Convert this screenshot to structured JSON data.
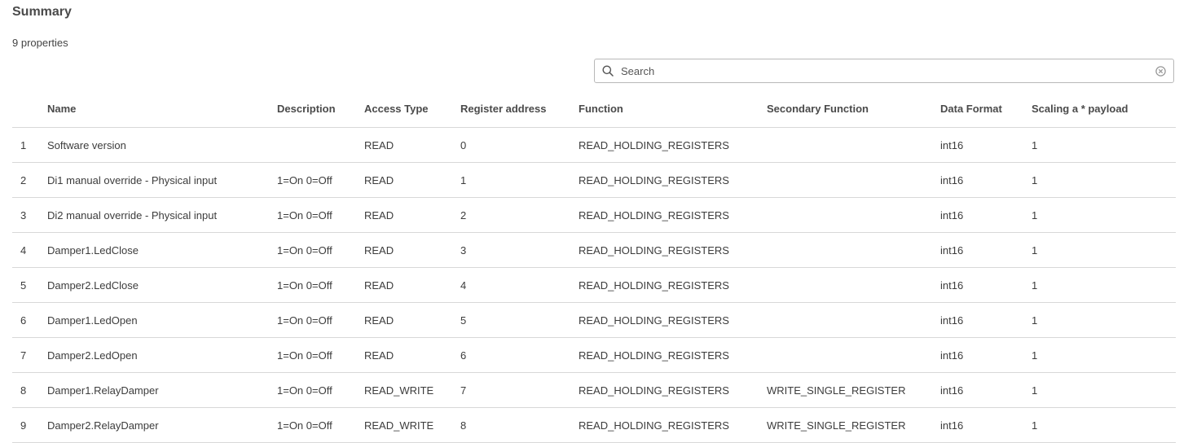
{
  "header": {
    "title": "Summary",
    "count_text": "9 properties"
  },
  "search": {
    "placeholder": "Search",
    "value": "",
    "icon": "search-icon",
    "clear_icon": "clear-icon"
  },
  "table": {
    "columns": {
      "index": "",
      "name": "Name",
      "description": "Description",
      "access_type": "Access Type",
      "register_address": "Register address",
      "function": "Function",
      "secondary_function": "Secondary Function",
      "data_format": "Data Format",
      "scaling": "Scaling a * payload"
    },
    "rows": [
      {
        "index": "1",
        "name": "Software version",
        "description": "",
        "access_type": "READ",
        "register_address": "0",
        "function": "READ_HOLDING_REGISTERS",
        "secondary_function": "",
        "data_format": "int16",
        "scaling": "1"
      },
      {
        "index": "2",
        "name": "Di1 manual override - Physical input",
        "description": "1=On 0=Off",
        "access_type": "READ",
        "register_address": "1",
        "function": "READ_HOLDING_REGISTERS",
        "secondary_function": "",
        "data_format": "int16",
        "scaling": "1"
      },
      {
        "index": "3",
        "name": "Di2 manual override - Physical input",
        "description": "1=On 0=Off",
        "access_type": "READ",
        "register_address": "2",
        "function": "READ_HOLDING_REGISTERS",
        "secondary_function": "",
        "data_format": "int16",
        "scaling": "1"
      },
      {
        "index": "4",
        "name": "Damper1.LedClose",
        "description": "1=On 0=Off",
        "access_type": "READ",
        "register_address": "3",
        "function": "READ_HOLDING_REGISTERS",
        "secondary_function": "",
        "data_format": "int16",
        "scaling": "1"
      },
      {
        "index": "5",
        "name": "Damper2.LedClose",
        "description": "1=On 0=Off",
        "access_type": "READ",
        "register_address": "4",
        "function": "READ_HOLDING_REGISTERS",
        "secondary_function": "",
        "data_format": "int16",
        "scaling": "1"
      },
      {
        "index": "6",
        "name": "Damper1.LedOpen",
        "description": "1=On 0=Off",
        "access_type": "READ",
        "register_address": "5",
        "function": "READ_HOLDING_REGISTERS",
        "secondary_function": "",
        "data_format": "int16",
        "scaling": "1"
      },
      {
        "index": "7",
        "name": "Damper2.LedOpen",
        "description": "1=On 0=Off",
        "access_type": "READ",
        "register_address": "6",
        "function": "READ_HOLDING_REGISTERS",
        "secondary_function": "",
        "data_format": "int16",
        "scaling": "1"
      },
      {
        "index": "8",
        "name": "Damper1.RelayDamper",
        "description": "1=On 0=Off",
        "access_type": "READ_WRITE",
        "register_address": "7",
        "function": "READ_HOLDING_REGISTERS",
        "secondary_function": "WRITE_SINGLE_REGISTER",
        "data_format": "int16",
        "scaling": "1"
      },
      {
        "index": "9",
        "name": "Damper2.RelayDamper",
        "description": "1=On 0=Off",
        "access_type": "READ_WRITE",
        "register_address": "8",
        "function": "READ_HOLDING_REGISTERS",
        "secondary_function": "WRITE_SINGLE_REGISTER",
        "data_format": "int16",
        "scaling": "1"
      }
    ]
  }
}
